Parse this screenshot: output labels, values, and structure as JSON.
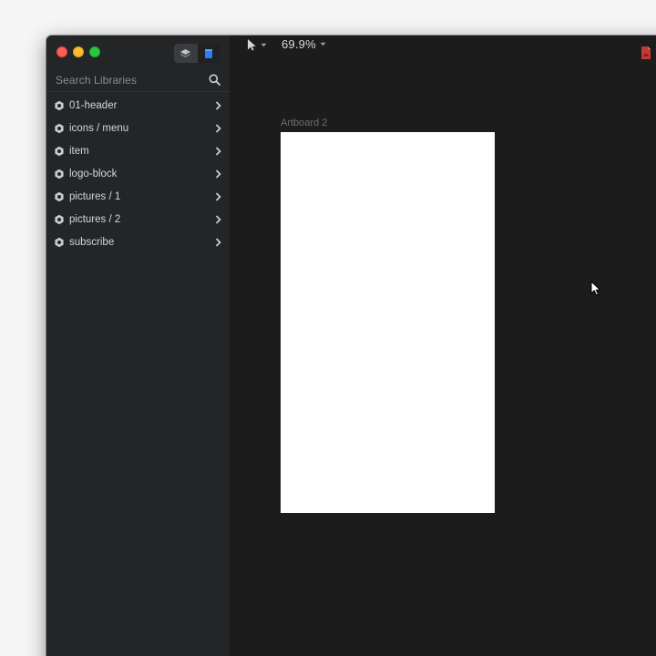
{
  "search": {
    "placeholder": "Search Libraries"
  },
  "libraries": [
    {
      "label": "01-header"
    },
    {
      "label": "icons / menu"
    },
    {
      "label": "item"
    },
    {
      "label": "logo-block"
    },
    {
      "label": "pictures / 1"
    },
    {
      "label": "pictures / 2"
    },
    {
      "label": "subscribe"
    }
  ],
  "toolbar": {
    "zoom": "69.9%"
  },
  "canvas": {
    "artboard_label": "Artboard 2"
  },
  "colors": {
    "sidebar_bg": "#232527",
    "canvas_bg": "#1c1c1c",
    "library_accent": "#3b82f6",
    "doc_icon": "#c23a35"
  },
  "icons": {
    "panel_layers": "layers-icon",
    "panel_library": "library-book-icon",
    "search": "search-icon",
    "library_item": "component-hexagon-icon",
    "chevron": "chevron-right-icon",
    "select_tool": "arrow-pointer-icon",
    "document": "document-icon"
  }
}
